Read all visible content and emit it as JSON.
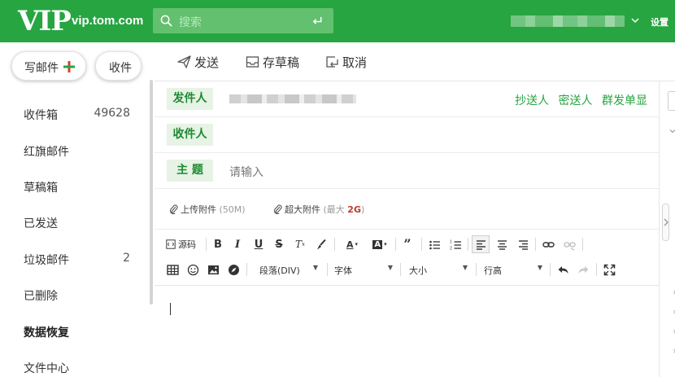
{
  "app": {
    "logo": "VIP",
    "domain": "vip.tom.com",
    "search_placeholder": "搜索",
    "settings_label": "设置",
    "brand_color": "#26a541"
  },
  "sidebar": {
    "compose_label": "写邮件",
    "receive_label": "收件",
    "folders": [
      {
        "label": "收件箱",
        "count": "49628"
      },
      {
        "label": "红旗邮件",
        "count": ""
      },
      {
        "label": "草稿箱",
        "count": ""
      },
      {
        "label": "已发送",
        "count": ""
      },
      {
        "label": "垃圾邮件",
        "count": "2"
      },
      {
        "label": "已删除",
        "count": ""
      },
      {
        "label": "数据恢复",
        "count": ""
      },
      {
        "label": "文件中心",
        "count": ""
      }
    ]
  },
  "toolbar": {
    "send_label": "发送",
    "save_draft_label": "存草稿",
    "cancel_label": "取消"
  },
  "compose": {
    "from_label": "发件人",
    "to_label": "收件人",
    "subject_label": "主 题",
    "subject_placeholder": "请输入",
    "links": {
      "cc": "抄送人",
      "bcc": "密送人",
      "separate": "群发单显"
    }
  },
  "attachments": {
    "upload_label": "上传附件",
    "upload_hint": "(50M)",
    "big_label": "超大附件",
    "big_hint_prefix": "(最大 ",
    "big_hint_size": "2G",
    "big_hint_suffix": ")"
  },
  "editor": {
    "source_label": "源码",
    "paragraph_select": "段落(DIV)",
    "font_select": "字体",
    "size_select": "大小",
    "line_height_select": "行高"
  }
}
